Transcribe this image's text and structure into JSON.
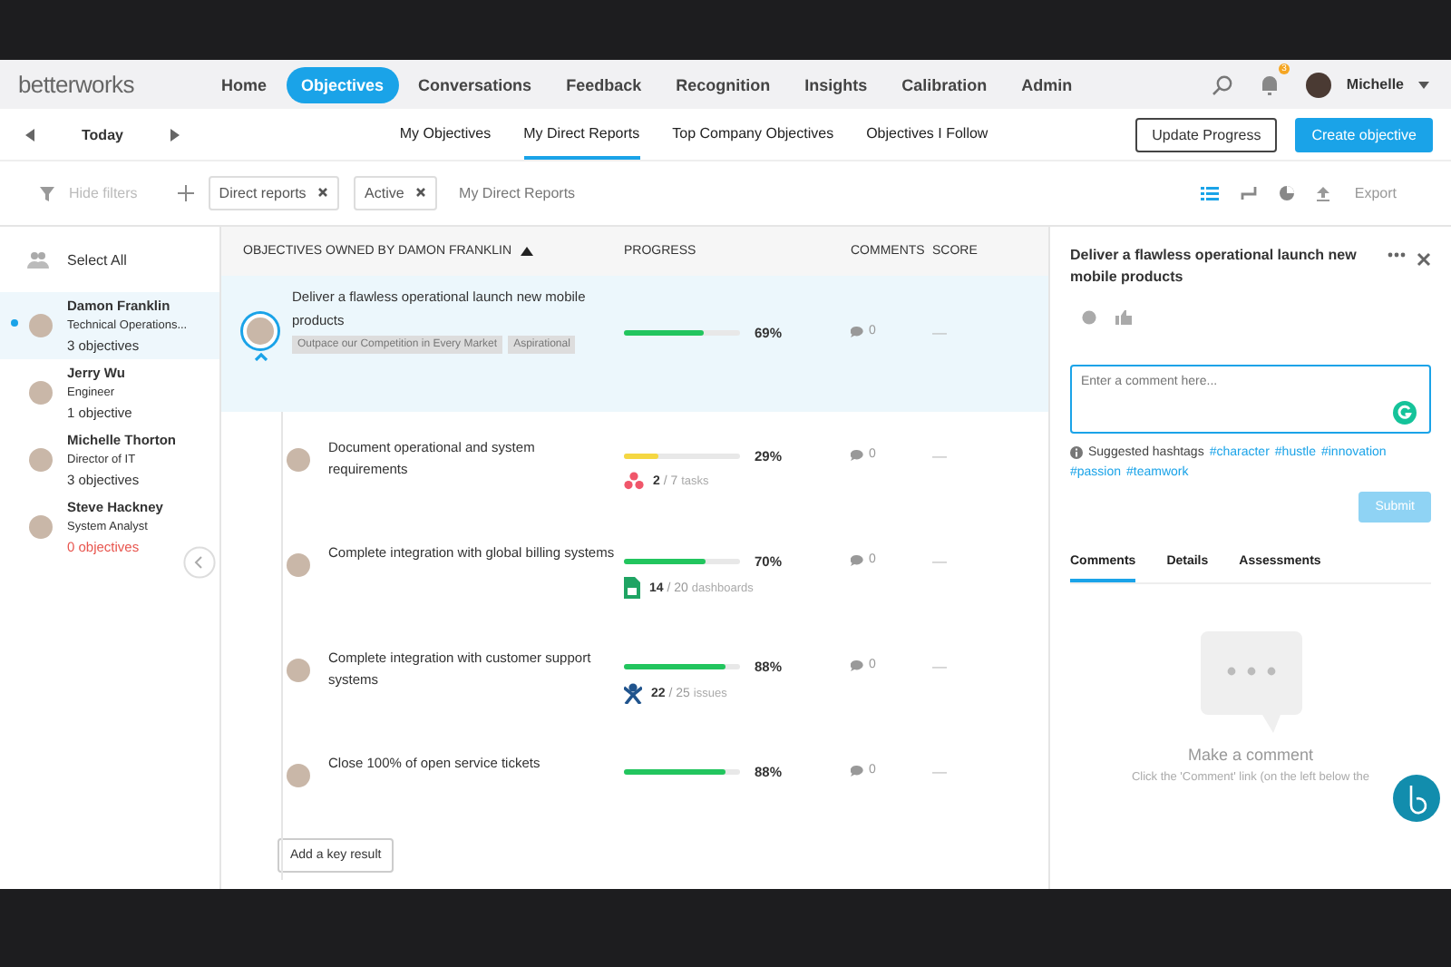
{
  "nav": {
    "logo": "betterworks",
    "items": [
      {
        "label": "Home",
        "selected": false
      },
      {
        "label": "Objectives",
        "selected": true
      },
      {
        "label": "Conversations",
        "selected": false
      },
      {
        "label": "Feedback",
        "selected": false
      },
      {
        "label": "Recognition",
        "selected": false
      },
      {
        "label": "Insights",
        "selected": false
      },
      {
        "label": "Calibration",
        "selected": false
      },
      {
        "label": "Admin",
        "selected": false
      }
    ],
    "notification_count": "3",
    "user": "Michelle"
  },
  "subnav": {
    "date": "Today",
    "tabs": [
      {
        "label": "My Objectives",
        "selected": false
      },
      {
        "label": "My Direct Reports",
        "selected": true
      },
      {
        "label": "Top Company Objectives",
        "selected": false
      },
      {
        "label": "Objectives I Follow",
        "selected": false
      }
    ],
    "buttons": [
      "Update Progress",
      "Create objective"
    ]
  },
  "filters": {
    "hide": "Hide filters",
    "chips": [
      "Direct reports",
      "Active"
    ],
    "view": "My Direct Reports",
    "export": "Export"
  },
  "sidebar": {
    "select_all": "Select All",
    "people": [
      {
        "name": "Damon Franklin",
        "role": "Technical Operations...",
        "count": "3 objectives",
        "selected": true,
        "alert": false
      },
      {
        "name": "Jerry Wu",
        "role": "Engineer",
        "count": "1 objective",
        "selected": false,
        "alert": false
      },
      {
        "name": "Michelle Thorton",
        "role": "Director of IT",
        "count": "3 objectives",
        "selected": false,
        "alert": false
      },
      {
        "name": "Steve Hackney",
        "role": "System Analyst",
        "count": "0 objectives",
        "selected": false,
        "alert": true
      }
    ]
  },
  "objectives": {
    "columns": [
      "OBJECTIVES OWNED BY DAMON FRANKLIN",
      "PROGRESS",
      "COMMENTS",
      "SCORE"
    ],
    "objective": {
      "title": "Deliver a flawless operational launch new mobile products",
      "tags": [
        "Outpace our Competition in Every Market",
        "Aspirational"
      ],
      "level": 0.69,
      "color": "#22c55e",
      "percent": "69%",
      "comments": "0",
      "score": "—"
    },
    "key_results": [
      {
        "title": "Document operational and system requirements",
        "level": 0.29,
        "color": "#f5d742",
        "percent": "29%",
        "comments": "0",
        "score": "—",
        "integration": {
          "kind": "asana",
          "done": "2",
          "total": "/ 7",
          "unit": "tasks"
        }
      },
      {
        "title": "Complete integration with global billing systems",
        "level": 0.7,
        "color": "#22c55e",
        "percent": "70%",
        "comments": "0",
        "score": "—",
        "integration": {
          "kind": "sheets",
          "done": "14",
          "total": "/ 20",
          "unit": "dashboards"
        }
      },
      {
        "title": "Complete integration with customer support systems",
        "level": 0.88,
        "color": "#22c55e",
        "percent": "88%",
        "comments": "0",
        "score": "—",
        "integration": {
          "kind": "jira",
          "done": "22",
          "total": "/ 25",
          "unit": "issues"
        }
      },
      {
        "title": "Close 100% of open service tickets",
        "level": 0.88,
        "color": "#22c55e",
        "percent": "88%",
        "comments": "0",
        "score": "—"
      }
    ],
    "add_button": "Add a key result"
  },
  "panel": {
    "title": "Deliver a flawless operational launch new mobile products",
    "comment_placeholder": "Enter a comment here...",
    "hashtags_label": "Suggested hashtags",
    "hashtags": [
      "#character",
      "#hustle",
      "#innovation",
      "#passion",
      "#teamwork"
    ],
    "submit": "Submit",
    "tabs": [
      {
        "label": "Comments",
        "selected": true
      },
      {
        "label": "Details",
        "selected": false
      },
      {
        "label": "Assessments",
        "selected": false
      }
    ],
    "empty_title": "Make a comment",
    "empty_text": "Click the 'Comment' link (on the left below the"
  }
}
